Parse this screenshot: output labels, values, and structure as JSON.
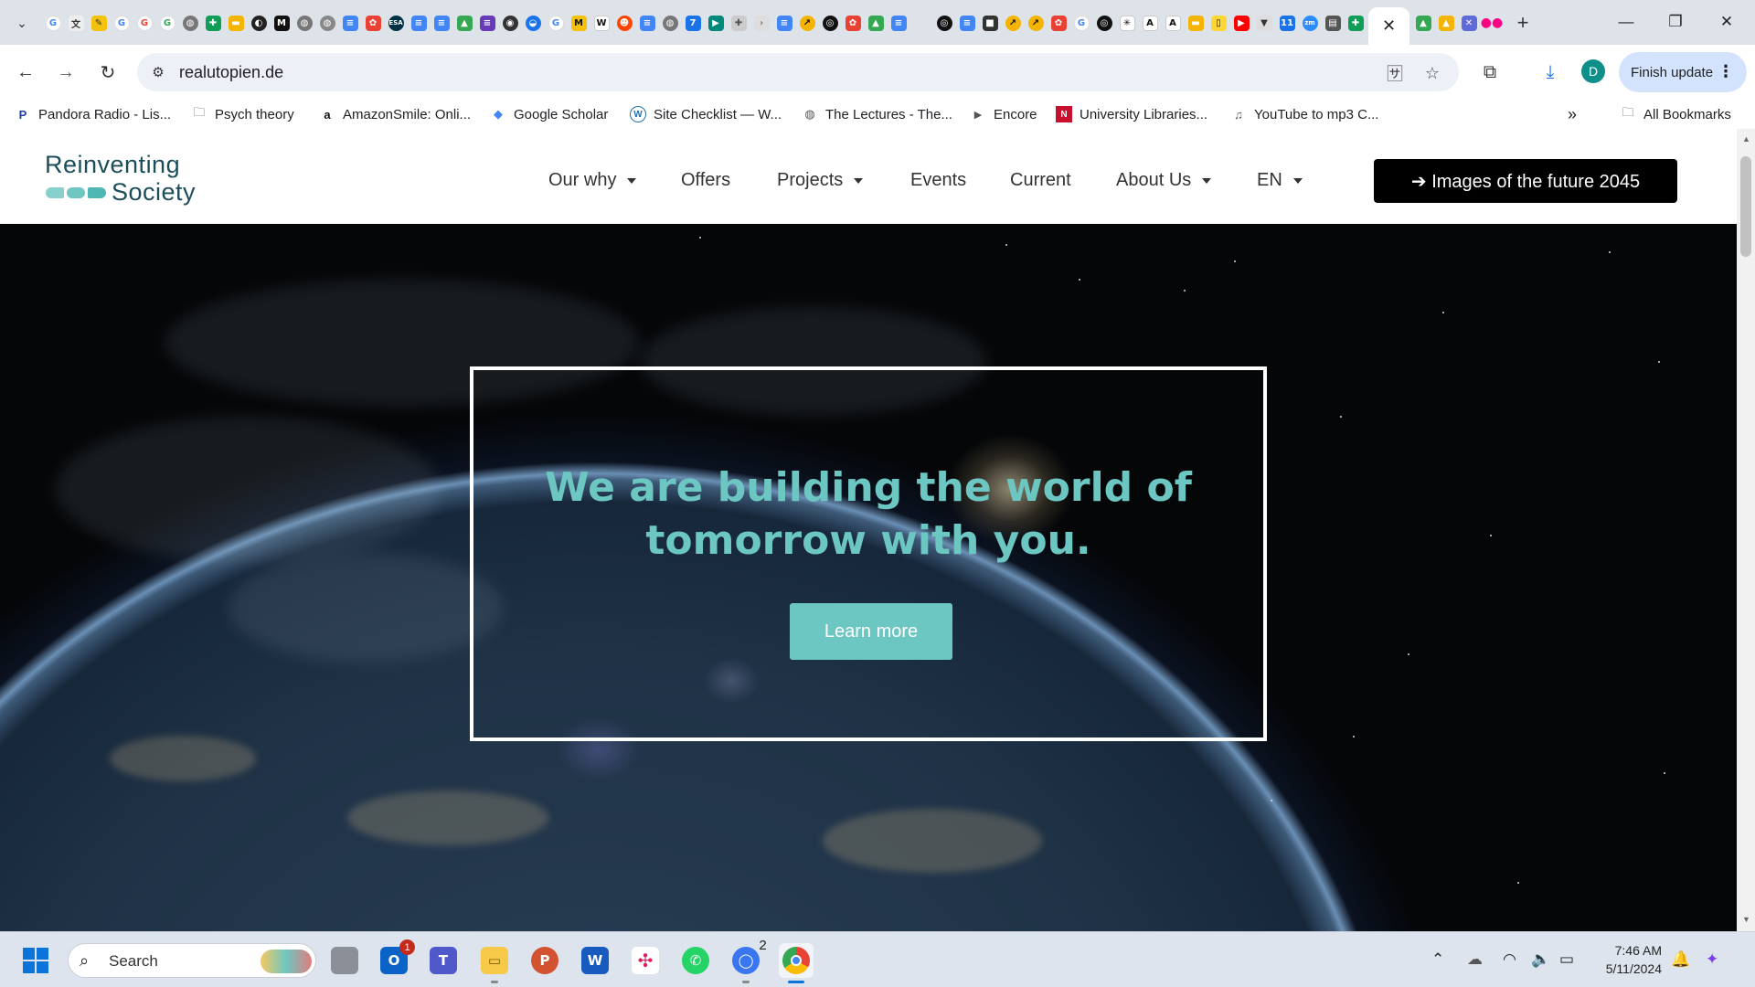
{
  "browser": {
    "active_tab_close": "✕",
    "new_tab": "+",
    "window": {
      "minimize": "—",
      "restore": "❐",
      "close": "✕"
    },
    "nav": {
      "back": "←",
      "forward": "→",
      "reload": "↻"
    },
    "url": "realutopien.de",
    "finish_update_label": "Finish update",
    "profile_initial": "D",
    "bookmarks": [
      {
        "label": "Pandora Radio - Lis...",
        "icon": "P",
        "color": "#224099"
      },
      {
        "label": "Psych theory",
        "icon": "🗀",
        "color": "#444444"
      },
      {
        "label": "AmazonSmile: Onli...",
        "icon": "a",
        "color": "#111111"
      },
      {
        "label": "Google Scholar",
        "icon": "◆",
        "color": "#4285f4"
      },
      {
        "label": "Site Checklist — W...",
        "icon": "W",
        "color": "#2271b1"
      },
      {
        "label": "The Lectures - The...",
        "icon": "◍",
        "color": "#555555"
      },
      {
        "label": "Encore",
        "icon": "▶",
        "color": "#555555"
      },
      {
        "label": "University Libraries...",
        "icon": "N",
        "color": "#c8102e"
      },
      {
        "label": "YouTube to mp3 C...",
        "icon": "♫",
        "color": "#555555"
      }
    ],
    "bookmarks_overflow": "»",
    "all_bookmarks_label": "All Bookmarks"
  },
  "site": {
    "logo": {
      "line1": "Reinventing",
      "line2": "Society"
    },
    "menu": [
      {
        "label": "Our why",
        "dropdown": true
      },
      {
        "label": "Offers",
        "dropdown": false
      },
      {
        "label": "Projects",
        "dropdown": true
      },
      {
        "label": "Events",
        "dropdown": false
      },
      {
        "label": "Current",
        "dropdown": false
      },
      {
        "label": "About Us",
        "dropdown": true
      },
      {
        "label": "EN",
        "dropdown": true
      }
    ],
    "cta_label": "➔ Images of the future 2045",
    "hero": {
      "title_line1": "We are building the world of",
      "title_line2": "tomorrow with you.",
      "button_label": "Learn more"
    },
    "colors": {
      "accent": "#6cc7c2",
      "logo_text": "#1c4e5a",
      "cta_bg": "#000000"
    }
  },
  "taskbar": {
    "search_placeholder": "Search",
    "outlook_badge": "1",
    "signal_badge": "2",
    "time": "7:46 AM",
    "date": "5/11/2024"
  }
}
